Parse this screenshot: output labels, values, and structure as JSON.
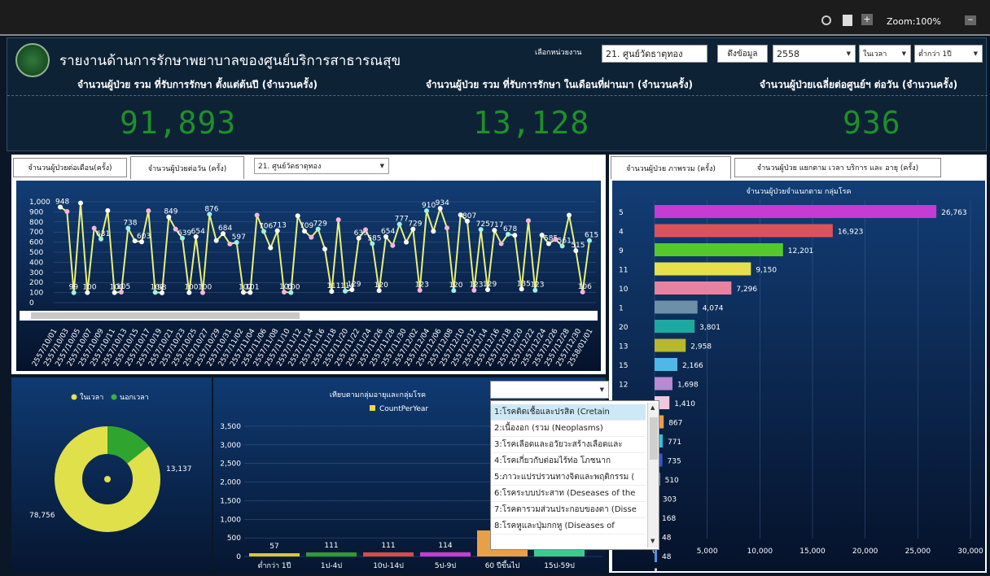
{
  "toolbar": {
    "zoom": "Zoom:100%"
  },
  "header": {
    "title": "รายงานด้านการรักษาพยาบาลของศูนย์บริการสาธารณสุข",
    "unit_label": "เลือกหน่วยงาน",
    "unit_value": "21. ศูนย์วัดธาตุทอง",
    "fetch_button": "ดึงข้อมูล",
    "year": "2558",
    "time_filter": "ในเวลา",
    "age_filter": "ต่ำกว่า 1ปี"
  },
  "kpis": [
    {
      "label": "จำนวนผู้ป่วย รวม ที่รับการรักษา ตั้งแต่ต้นปี (จำนวนครั้ง)",
      "value": "91,893"
    },
    {
      "label": "จำนวนผู้ป่วย รวม ที่รับการรักษา ในเดือนที่ผ่านมา (จำนวนครั้ง)",
      "value": "13,128"
    },
    {
      "label": "จำนวนผู้ป่วยเฉลี่ยต่อศูนย์ฯ ต่อวัน (จำนวนครั้ง)",
      "value": "936"
    }
  ],
  "line_panel": {
    "tabs": [
      "จำนวนผู้ป่วยต่อเดือน(ครั้ง)",
      "จำนวนผู้ป่วยต่อวัน (ครั้ง)"
    ],
    "center_select": "21. ศูนย์วัดธาตุทอง"
  },
  "bar_panel": {
    "tabs": [
      "จำนวนผู้ป่วย ภาพรวม (ครั้ง)",
      "จำนวนผู้ป่วย แยกตาม เวลา บริการ และ อายุ (ครั้ง)"
    ]
  },
  "chart_data": [
    {
      "type": "line",
      "ylim": [
        0,
        1000
      ],
      "yticks": [
        "0",
        "100",
        "200",
        "300",
        "400",
        "500",
        "600",
        "700",
        "800",
        "900",
        "1,000"
      ],
      "x_labels": [
        "2557/10/01",
        "2557/10/03",
        "2557/10/05",
        "2557/10/07",
        "2557/10/09",
        "2557/10/11",
        "2557/10/13",
        "2557/10/15",
        "2557/10/17",
        "2557/10/19",
        "2557/10/21",
        "2557/10/23",
        "2557/10/25",
        "2557/10/27",
        "2557/10/29",
        "2557/10/31",
        "2557/11/02",
        "2557/11/04",
        "2557/11/06",
        "2557/11/08",
        "2557/11/10",
        "2557/11/12",
        "2557/11/14",
        "2557/11/16",
        "2557/11/18",
        "2557/11/20",
        "2557/11/22",
        "2557/11/24",
        "2557/11/26",
        "2557/11/28",
        "2557/11/30",
        "2557/12/02",
        "2557/12/04",
        "2557/12/06",
        "2557/12/08",
        "2557/12/10",
        "2557/12/12",
        "2557/12/14",
        "2557/12/16",
        "2557/12/18",
        "2557/12/20",
        "2557/12/22",
        "2557/12/24",
        "2557/12/26",
        "2557/12/28",
        "2557/12/30",
        "2558/01/01"
      ],
      "values": [
        948,
        903,
        99,
        988,
        100,
        738,
        631,
        912,
        100,
        105,
        738,
        612,
        603,
        910,
        102,
        98,
        849,
        729,
        639,
        100,
        654,
        100,
        876,
        615,
        684,
        582,
        597,
        102,
        101,
        867,
        706,
        543,
        713,
        105,
        100,
        861,
        709,
        648,
        729,
        531,
        111,
        822,
        114,
        129,
        639,
        723,
        585,
        120,
        654,
        567,
        777,
        600,
        729,
        123,
        910,
        708,
        934,
        741,
        120,
        870,
        807,
        123,
        725,
        129,
        717,
        585,
        678,
        667,
        135,
        813,
        123,
        669,
        585,
        627,
        561,
        867,
        515,
        106,
        615
      ]
    },
    {
      "type": "bar",
      "title": "จำนวนผู้ป่วยจำแนกตาม กลุ่มโรค",
      "categories": [
        "5",
        "4",
        "9",
        "11",
        "10",
        "1",
        "20",
        "13",
        "15",
        "12",
        "18",
        "",
        "",
        "",
        "",
        "",
        "",
        "",
        ""
      ],
      "values": [
        26763,
        16923,
        12201,
        9150,
        7296,
        4074,
        3801,
        2958,
        2166,
        1698,
        1410,
        867,
        771,
        735,
        510,
        303,
        168,
        48,
        48,
        3
      ],
      "xlim": [
        0,
        30000
      ],
      "xticks": [
        "0",
        "5,000",
        "10,000",
        "15,000",
        "20,000",
        "25,000",
        "30,000"
      ]
    },
    {
      "type": "pie",
      "legend": [
        "ในเวลา",
        "นอกเวลา"
      ],
      "values": [
        78756,
        13137
      ],
      "labels": [
        "78,756",
        "13,137"
      ]
    },
    {
      "type": "bar",
      "title": "เทียบตามกลุ่มอายุและกลุ่มโรค",
      "legend": "CountPerYear",
      "categories": [
        "ต่ำกว่า 1ปี",
        "1ป-4ป",
        "10ป-14ป",
        "5ป-9ป",
        "60 ปีขึ้นไป",
        "15ป-59ป"
      ],
      "values": [
        57,
        111,
        111,
        114,
        700,
        1000
      ],
      "ylim": [
        0,
        3500
      ],
      "yticks": [
        "0",
        "500",
        "1,000",
        "1,500",
        "2,000",
        "2,500",
        "3,000",
        "3,500"
      ]
    }
  ],
  "dropdown": {
    "items": [
      "1:โรคติดเชื้อและปรสิต (Cretain",
      "2:เนื้องอก (รวม (Neoplasms)",
      "3:โรคเลือดและอวัยวะสร้างเลือดและ",
      "4:โรคเกี่ยวกับต่อมไร้ท่อ โภชนาก",
      "5:ภาวะแปรปรวนทางจิตและพฤติกรรม (",
      "6:โรคระบบประสาท (Deseases of the",
      "7:โรคตารวมส่วนประกอบของตา (Disse",
      "8:โรคหูและปุ่มกกหู (Diseases of"
    ]
  }
}
